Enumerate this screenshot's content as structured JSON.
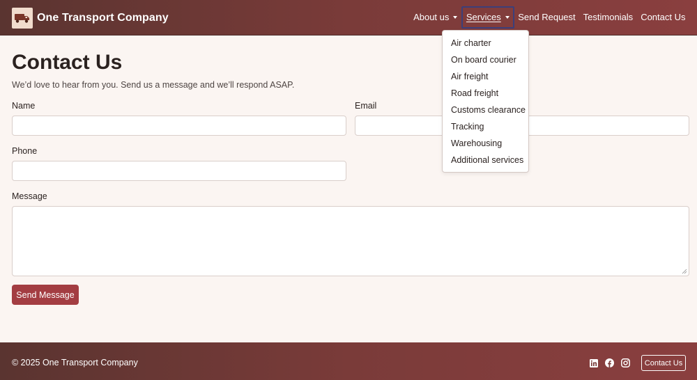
{
  "brand": {
    "name": "One Transport Company",
    "logo_icon": "truck-icon"
  },
  "nav": {
    "items": [
      {
        "label": "About us",
        "has_caret": true
      },
      {
        "label": "Services",
        "has_caret": true,
        "active": true
      },
      {
        "label": "Send Request"
      },
      {
        "label": "Testimonials"
      },
      {
        "label": "Contact Us"
      }
    ]
  },
  "services_menu": [
    "Air charter",
    "On board courier",
    "Air freight",
    "Road freight",
    "Customs clearance",
    "Tracking",
    "Warehousing",
    "Additional services"
  ],
  "contact": {
    "title": "Contact Us",
    "subtitle": "We’d love to hear from you. Send us a message and we’ll respond ASAP.",
    "name_label": "Name",
    "email_label": "Email",
    "phone_label": "Phone",
    "message_label": "Message",
    "name_value": "",
    "email_value": "",
    "phone_value": "",
    "message_value": "",
    "submit_label": "Send Message"
  },
  "footer": {
    "copyright": "© 2025 One Transport Company",
    "socials": [
      "linkedin-icon",
      "facebook-icon",
      "instagram-icon"
    ],
    "contact_button": "Contact Us"
  },
  "colors": {
    "nav_gradient_start": "#5a3430",
    "nav_gradient_end": "#8a3f3f",
    "accent": "#a33d42",
    "page_background": "#fbf5f2"
  }
}
